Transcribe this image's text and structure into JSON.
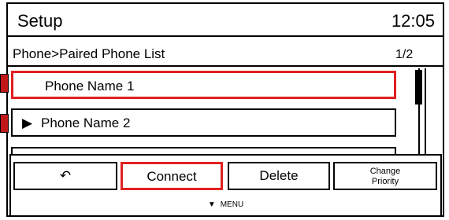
{
  "header": {
    "title": "Setup",
    "clock": "12:05"
  },
  "breadcrumb": {
    "path": "Phone>Paired Phone List",
    "page": "1/2"
  },
  "list": {
    "items": [
      {
        "label": "Phone Name 1",
        "selected": true
      },
      {
        "label": "Phone Name 2",
        "selected": false,
        "marker": "▶"
      },
      {
        "label": "",
        "selected": false
      }
    ]
  },
  "menu": {
    "back_icon": "↶",
    "connect_label": "Connect",
    "delete_label": "Delete",
    "change_priority_line1": "Change",
    "change_priority_line2": "Priority",
    "hint_arrow": "▼",
    "hint_label": "MENU"
  },
  "colors": {
    "highlight": "#e02020",
    "side_tab": "#c01818"
  }
}
